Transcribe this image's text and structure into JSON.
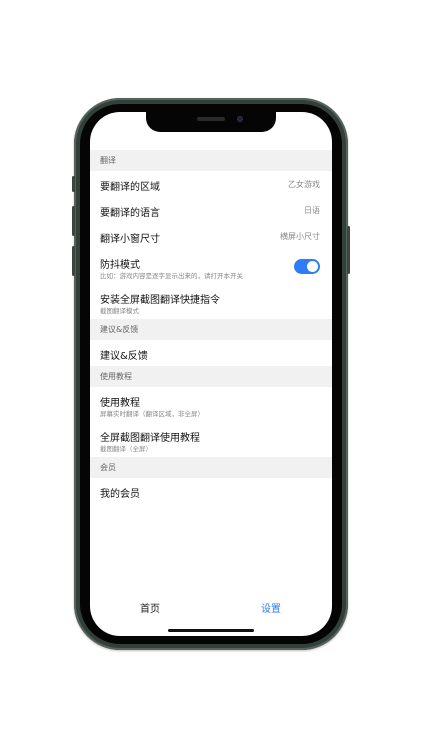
{
  "sections": [
    {
      "header": "翻译",
      "rows": [
        {
          "label": "要翻译的区域",
          "value": "乙女游戏"
        },
        {
          "label": "要翻译的语言",
          "value": "日语"
        },
        {
          "label": "翻译小窗尺寸",
          "value": "横屏小尺寸"
        },
        {
          "label": "防抖模式",
          "sub": "比如：游戏内容是逐字显示出来的，请打开本开关",
          "toggle_on": true
        },
        {
          "label": "安装全屏截图翻译快捷指令",
          "sub": "截图翻译模式"
        }
      ]
    },
    {
      "header": "建议&反馈",
      "rows": [
        {
          "label": "建议&反馈"
        }
      ]
    },
    {
      "header": "使用教程",
      "rows": [
        {
          "label": "使用教程",
          "sub": "屏幕实时翻译（翻译区域，非全屏）"
        },
        {
          "label": "全屏截图翻译使用教程",
          "sub": "截图翻译（全屏）"
        }
      ]
    },
    {
      "header": "会员",
      "rows": [
        {
          "label": "我的会员"
        }
      ]
    }
  ],
  "tabs": {
    "home": "首页",
    "settings": "设置"
  },
  "colors": {
    "accent": "#2f7cf6",
    "frame": "#33403a",
    "section_bg": "#f1f1f1"
  }
}
